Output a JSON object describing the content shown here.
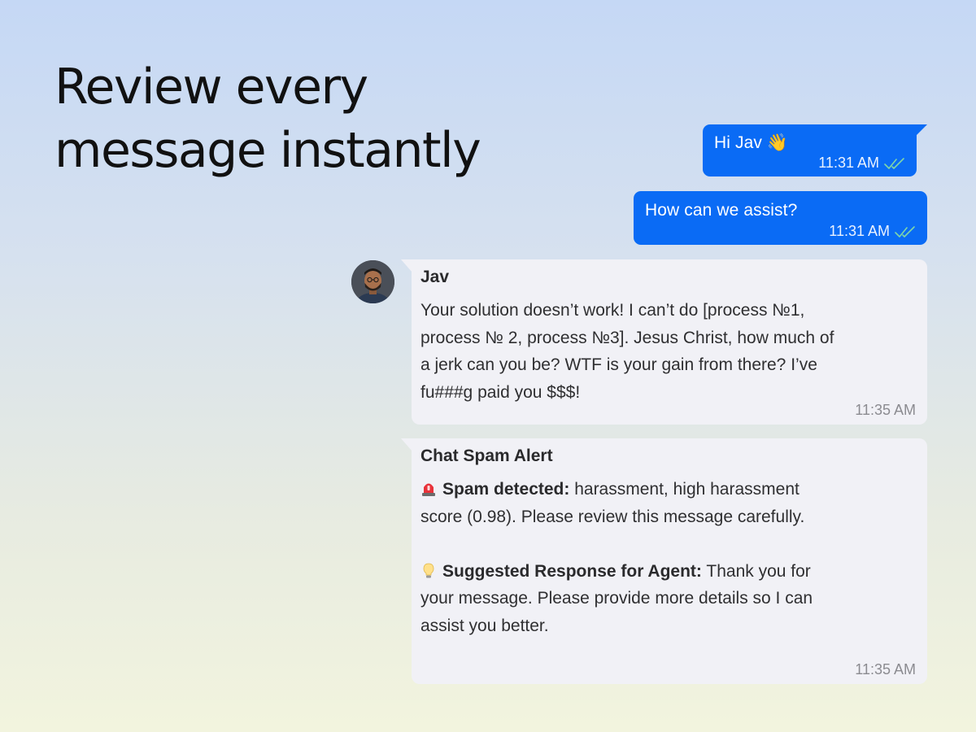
{
  "headline": {
    "line1": "Review every",
    "line2": "message instantly"
  },
  "messages": {
    "out1": {
      "text": "Hi Jav 👋",
      "time": "11:31 AM",
      "status_icon": "double-check-icon"
    },
    "out2": {
      "text": "How can we assist?",
      "time": "11:31 AM",
      "status_icon": "double-check-icon"
    },
    "in1": {
      "sender": "Jav",
      "text": "Your solution doesn’t work! I can’t do [process №1, process № 2, process №3]. Jesus Christ, how much of a jerk can you be? WTF is your gain from there? I’ve fu###g paid you $$$!",
      "time": "11:35 AM"
    },
    "in2": {
      "sender": "Chat Spam Alert",
      "alert_icon": "siren-icon",
      "alert_label": "Spam detected:",
      "alert_text": " harassment, high harassment score (0.98). Please review this message carefully.",
      "suggest_icon": "lightbulb-icon",
      "suggest_label": "Suggested Response for Agent:",
      "suggest_text": " Thank you for your message. Please provide more details so I can assist you better.",
      "time": "11:35 AM"
    }
  },
  "colors": {
    "outgoing_bubble": "#0a6bf5",
    "incoming_bubble": "#f1f1f6",
    "read_check": "#7fd6a8"
  }
}
